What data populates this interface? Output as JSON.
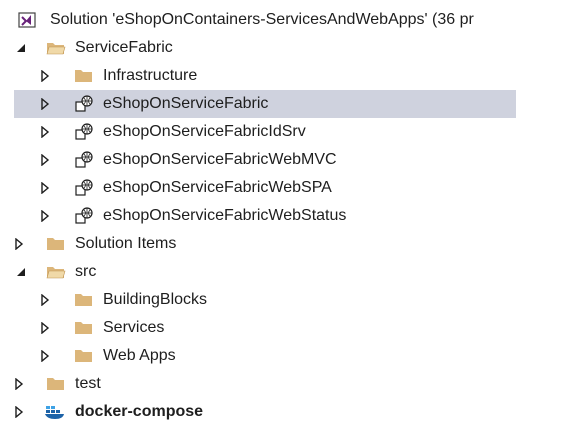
{
  "tree": {
    "solution": {
      "label": "Solution 'eShopOnContainers-ServicesAndWebApps' (36 pr",
      "icon": "visual-studio-solution-icon"
    },
    "items": [
      {
        "label": "ServiceFabric",
        "icon": "folder-open-icon",
        "expanded": true
      },
      {
        "label": "Infrastructure",
        "icon": "folder-icon",
        "expanded": false
      },
      {
        "label": "eShopOnServiceFabric",
        "icon": "service-fabric-project-icon",
        "expanded": false,
        "selected": true
      },
      {
        "label": "eShopOnServiceFabricIdSrv",
        "icon": "service-fabric-project-icon",
        "expanded": false
      },
      {
        "label": "eShopOnServiceFabricWebMVC",
        "icon": "service-fabric-project-icon",
        "expanded": false
      },
      {
        "label": "eShopOnServiceFabricWebSPA",
        "icon": "service-fabric-project-icon",
        "expanded": false
      },
      {
        "label": "eShopOnServiceFabricWebStatus",
        "icon": "service-fabric-project-icon",
        "expanded": false
      },
      {
        "label": "Solution Items",
        "icon": "folder-icon",
        "expanded": false
      },
      {
        "label": "src",
        "icon": "folder-open-icon",
        "expanded": true
      },
      {
        "label": "BuildingBlocks",
        "icon": "folder-icon",
        "expanded": false
      },
      {
        "label": "Services",
        "icon": "folder-icon",
        "expanded": false
      },
      {
        "label": "Web Apps",
        "icon": "folder-icon",
        "expanded": false
      },
      {
        "label": "test",
        "icon": "folder-icon",
        "expanded": false
      },
      {
        "label": "docker-compose",
        "icon": "docker-compose-icon",
        "expanded": false,
        "bold": true
      }
    ]
  },
  "colors": {
    "selection": "#cfd2de",
    "folder": "#dcb67a",
    "folder_dark": "#c09553",
    "vs_purple": "#68217a",
    "docker_blue": "#1d63a8",
    "docker_light": "#3ea2e5",
    "text": "#1e1e1e",
    "expander": "#1e1e1e"
  }
}
